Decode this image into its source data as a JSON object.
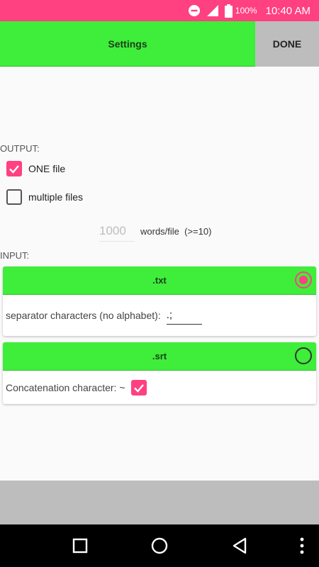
{
  "status_bar": {
    "battery_percent": "100%",
    "time": "10:40 AM",
    "icons": [
      "do-not-disturb-icon",
      "signal-icon",
      "battery-icon"
    ]
  },
  "toolbar": {
    "title": "Settings",
    "done_label": "DONE"
  },
  "output": {
    "label": "OUTPUT:",
    "one_file": {
      "label": "ONE file",
      "checked": true
    },
    "multiple_files": {
      "label": "multiple files",
      "checked": false
    },
    "words_per_file": {
      "placeholder": "1000",
      "unit_label": "words/file  (>=10)"
    }
  },
  "input": {
    "label": "INPUT:",
    "txt_card": {
      "title": ".txt",
      "selected": true,
      "separator_label": "separator characters (no alphabet):",
      "separator_value": ".;"
    },
    "srt_card": {
      "title": ".srt",
      "selected": false,
      "concat_label": "Concatenation character: ~",
      "concat_checked": true
    }
  },
  "colors": {
    "accent": "#ff4081",
    "header_green": "#3eee3a",
    "done_gray": "#bdbdbd"
  }
}
